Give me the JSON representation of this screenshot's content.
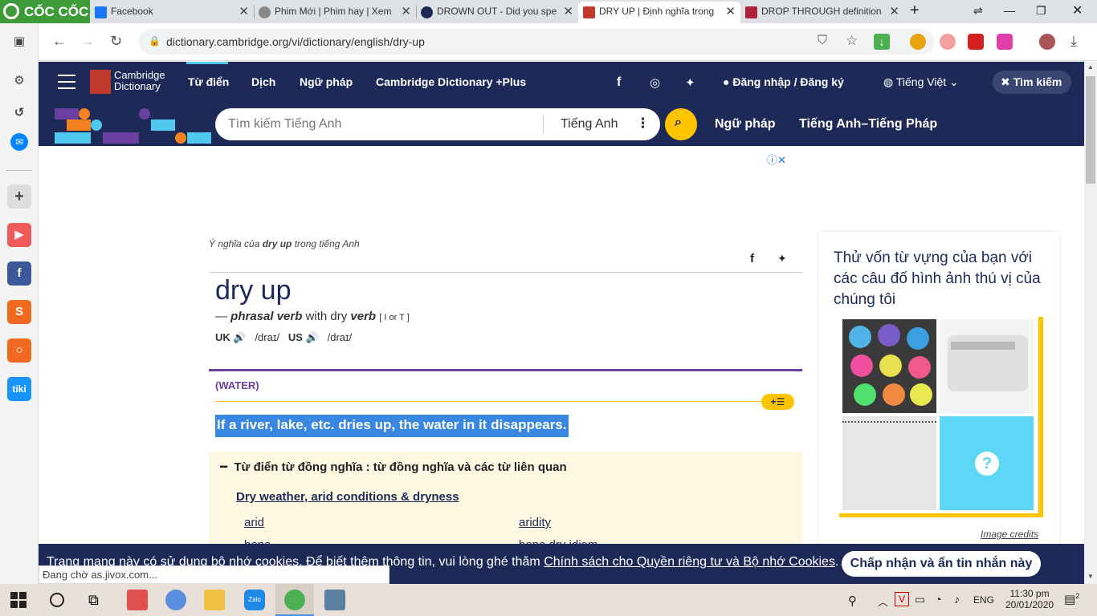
{
  "browser": {
    "brand": "CỐC CỐC",
    "tabs": [
      {
        "title": "Facebook"
      },
      {
        "title": "Phim Mới | Phim hay | Xem"
      },
      {
        "title": "DROWN OUT - Did you spe"
      },
      {
        "title": "DRY UP | Định nghĩa trong"
      },
      {
        "title": "DROP THROUGH definition"
      }
    ],
    "new_tab": "+",
    "url": "dictionary.cambridge.org/vi/dictionary/english/dry-up",
    "status": "Đang chờ as.jivox.com..."
  },
  "site": {
    "logo_line1": "Cambridge",
    "logo_line2": "Dictionary",
    "nav": [
      "Từ điển",
      "Dịch",
      "Ngữ pháp",
      "Cambridge Dictionary +Plus"
    ],
    "login": "Đăng nhập / Đăng ký",
    "language": "Tiếng Việt",
    "search_close": "Tìm kiếm",
    "search_placeholder": "Tìm kiếm Tiếng Anh",
    "search_lang": "Tiếng Anh",
    "subnav": [
      "Ngữ pháp",
      "Tiếng Anh–Tiếng Pháp"
    ]
  },
  "entry": {
    "breadcrumb_pre": "Ý nghĩa của ",
    "breadcrumb_word": "dry up",
    "breadcrumb_post": " trong tiếng Anh",
    "headword": "dry up",
    "pos_dash": "— ",
    "pos": "phrasal verb",
    "pos_with": " with dry ",
    "pos_verb": "verb",
    "grammar": "[ I or T ]",
    "uk_label": "UK",
    "uk_ipa": "/draɪ/",
    "us_label": "US",
    "us_ipa": "/draɪ/",
    "guideword": "(WATER)",
    "definition": "If a river, lake, etc. dries up, the water in it disappears.",
    "thesaurus_title": "Từ điển từ đồng nghĩa : từ đồng nghĩa và các từ liên quan",
    "thesaurus_sub": "Dry weather, arid conditions & dryness",
    "thesaurus_words": [
      "arid",
      "aridity",
      "bone",
      "bone dry idiom"
    ]
  },
  "quiz": {
    "title": "Thử vốn từ vựng của bạn với các câu đố hình ảnh thú vị của chúng tôi",
    "question_mark": "?",
    "credits": "Image credits"
  },
  "cookie": {
    "text_pre": "Trang mạng này có sử dụng bộ nhớ cookies. Để biết thêm thông tin, vui lòng ghé thăm ",
    "link": "Chính sách cho Quyền riêng tư và Bộ nhớ Cookies",
    "text_post": ".",
    "button": "Chấp nhận và ẩn tin nhắn này"
  },
  "taskbar": {
    "lang": "ENG",
    "time": "11:30 pm",
    "date": "20/01/2020",
    "notif_count": "2"
  },
  "colors": {
    "brand_navy": "#1d2a57",
    "highlight_blue": "#3987e0",
    "accent_yellow": "#fec400",
    "guide_purple": "#6b3fa0",
    "thesaurus_bg": "#fef7e1"
  }
}
